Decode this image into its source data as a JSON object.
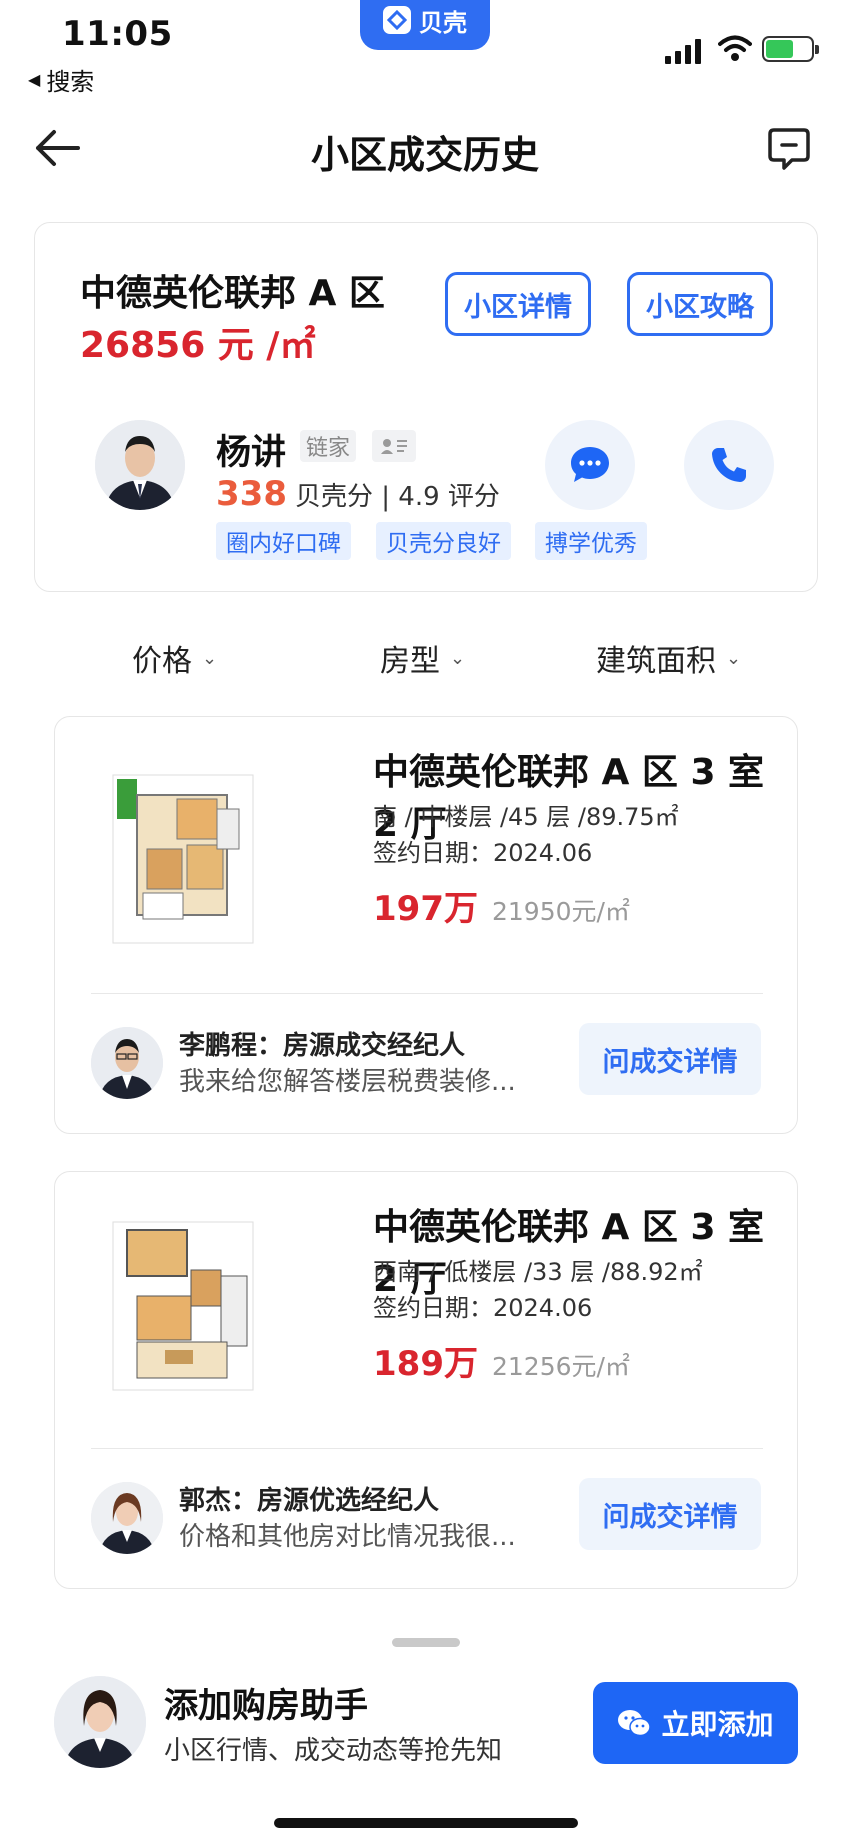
{
  "status_bar": {
    "time": "11:05",
    "back_app": "搜索",
    "app_name": "贝壳"
  },
  "nav": {
    "title": "小区成交历史"
  },
  "community": {
    "name": "中德英伦联邦 A 区",
    "price": "26856 元 /㎡",
    "detail_button": "小区详情",
    "guide_button": "小区攻略"
  },
  "agent": {
    "name": "杨讲",
    "company": "链家",
    "score": "338",
    "score_text": "贝壳分 | 4.9 评分",
    "tags": [
      "圈内好口碑",
      "贝壳分良好",
      "搏学优秀"
    ]
  },
  "filters": {
    "price": "价格",
    "type": "房型",
    "area": "建筑面积"
  },
  "listings": [
    {
      "title": "中德英伦联邦 A 区 3 室 2 厅",
      "meta": "南 / 中楼层 /45 层 /89.75㎡",
      "date": "签约日期：2024.06",
      "total": "197万",
      "unit": "21950元/㎡",
      "broker_line": "李鹏程：房源成交经纪人",
      "broker_msg": "我来给您解答楼层税费装修...",
      "ask_button": "问成交详情"
    },
    {
      "title": "中德英伦联邦 A 区 3 室 2 厅",
      "meta": "西南 / 低楼层 /33 层 /88.92㎡",
      "date": "签约日期：2024.06",
      "total": "189万",
      "unit": "21256元/㎡",
      "broker_line": "郭杰：房源优选经纪人",
      "broker_msg": "价格和其他房对比情况我很...",
      "ask_button": "问成交详情"
    }
  ],
  "assistant": {
    "title": "添加购房助手",
    "subtitle": "小区行情、成交动态等抢先知",
    "add_button": "立即添加"
  },
  "colors": {
    "accent": "#2f6df2",
    "price_red": "#d9252e",
    "score_orange": "#ea5c3c"
  }
}
